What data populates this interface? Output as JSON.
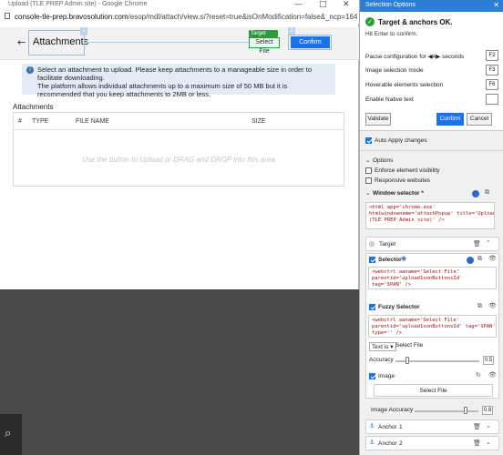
{
  "browser": {
    "window_title": "Upload (TLE PREP Admin site) - Google Chrome",
    "minimize": "—",
    "maximize": "□",
    "close": "✕",
    "url_host": "console-tle-prep.bravosolution.com",
    "url_path": "/esop/mdl/attach/view.si?reset=true&isOnModification=false&_ncp=164941722578..."
  },
  "page": {
    "back_glyph": "←",
    "title": "Attachments",
    "target_tag": "Target",
    "select_file": "Select File",
    "confirm": "Confirm",
    "marker1": "1",
    "marker2": "2",
    "info_text": "Select an attachment to upload. Please keep attachments to a manageable size in order to facilitate downloading.\nThe platform allows individual attachments up to a maximum size of 50 MB but it is recommended that you keep attachments to 2MB or less.",
    "attachments_label": "Attachments",
    "columns": [
      "#",
      "TYPE",
      "FILE NAME",
      "SIZE"
    ],
    "empty_message": "Use the button to Upload or DRAG and DROP into this area"
  },
  "panel": {
    "title": "Selection Options",
    "close": "✕",
    "status": "Target & anchors OK.",
    "hint": "Hit Enter to confirm.",
    "pause_label": "Pause configuration for  ◀4▶  seconds",
    "pause_key": "F2",
    "image_mode_label": "Image selection mode",
    "image_mode_key": "F3",
    "hover_label": "Hoverable elements selection",
    "hover_key": "F6",
    "native_label": "Enable Native text",
    "native_key": "",
    "validate": "Validate",
    "confirm": "Confirm",
    "cancel": "Cancel",
    "auto_apply": "Auto Apply changes",
    "options_header": "Options",
    "enforce": "Enforce element visibility",
    "responsive": "Responsive websites",
    "window_selector": "Window selector *",
    "window_selector_code": "<html app='chrome.exe'\nhtmlwindowname='attachPopup' title='Upload\n(TLE PREP Admin site)' />",
    "target_label": "Target",
    "selector_label": "Selector",
    "selector_code": "<webctrl aaname='Select File'\nparentid='upload1sonButtonsId'\ntag='SPAN' />",
    "fuzzy_label": "Fuzzy Selector",
    "fuzzy_code": "<webctrl aaname='Select File'\nparentid='upload1sonButtonsId' tag='SPAN'\ntype='' />",
    "text_is": "Text is ▾",
    "text_value": "Select File",
    "accuracy_label": "Accuracy",
    "accuracy_value": "0.5",
    "accuracy": 0.5,
    "image_label": "Image",
    "image_button": "Select File",
    "image_accuracy_label": "Image Accuracy",
    "image_accuracy_value": "0.8",
    "image_accuracy": 0.8,
    "anchor1_label": "Anchor",
    "anchor1_num": "1",
    "anchor2_label": "Anchor",
    "anchor2_num": "2"
  },
  "colors": {
    "accent": "#1a73e8",
    "panel_title": "#2a7fd4",
    "target_green": "#2f9a3b",
    "info_bg": "#e3ecf6",
    "code_red": "#a01010"
  }
}
